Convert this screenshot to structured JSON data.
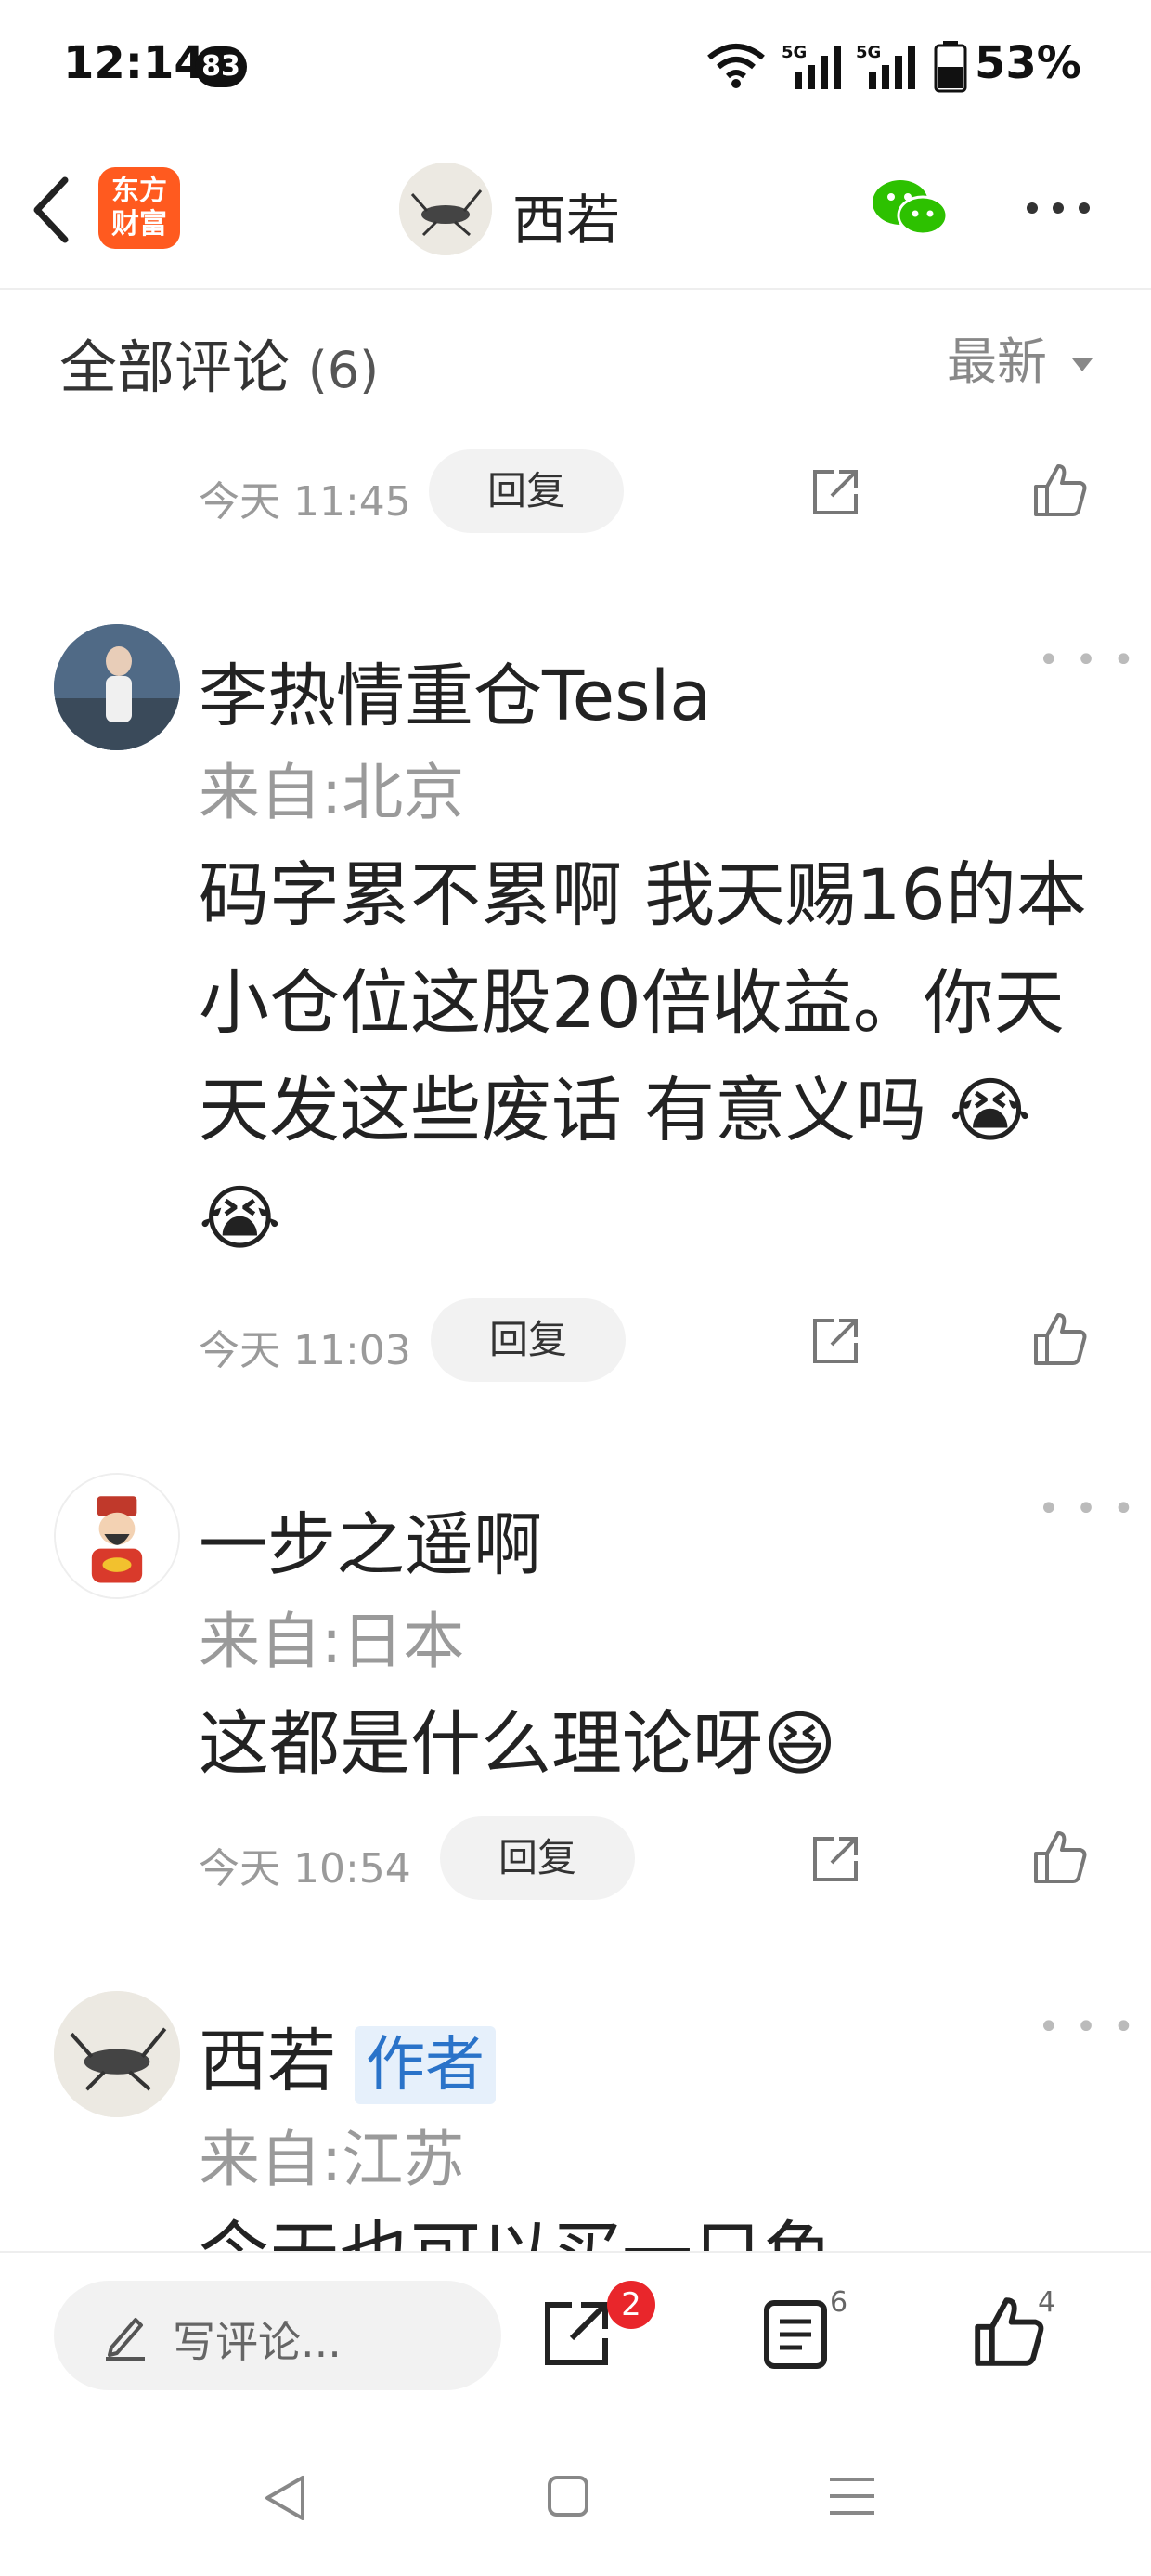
{
  "status_bar": {
    "time": "12:14",
    "notif_count": "83",
    "battery": "53%",
    "network": "5G"
  },
  "header": {
    "back_label": "back",
    "logo_text": "东方\n财富",
    "title": "西若"
  },
  "section": {
    "title": "全部评论",
    "count": "(6)",
    "sort": "最新"
  },
  "prev_comment": {
    "time": "今天 11:45",
    "reply": "回复"
  },
  "comments": [
    {
      "username": "李热情重仓Tesla",
      "location": "来自:北京",
      "text": "码字累不累啊 我天赐16的本 小仓位这股20倍收益。你天天发这些废话  有意义吗 😭😭",
      "time": "今天 11:03",
      "reply": "回复"
    },
    {
      "username": "一步之遥啊",
      "location": "来自:日本",
      "text": "这都是什么理论呀😆",
      "time": "今天 10:54",
      "reply": "回复"
    },
    {
      "username": "西若",
      "author_tag": "作者",
      "location": "来自:江苏",
      "text": "今天也可以买一只鱼"
    }
  ],
  "bottom_bar": {
    "write_placeholder": "写评论...",
    "share_badge": "2",
    "comment_count": "6",
    "like_count": "4"
  },
  "colors": {
    "accent_orange": "#ff5a1f",
    "wechat_green": "#2dc100",
    "badge_red": "#e9262b",
    "author_blue": "#2a73c9"
  }
}
